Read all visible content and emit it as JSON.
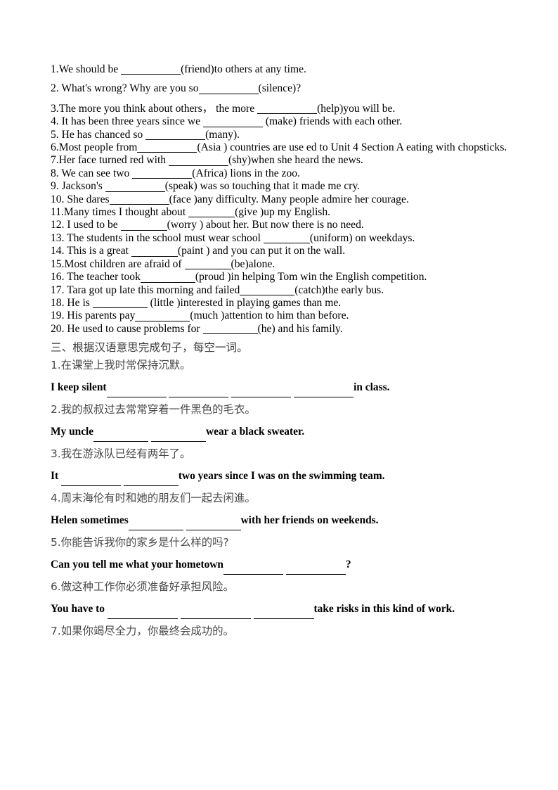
{
  "document": {
    "type": "english-grammar-worksheet",
    "page_background": "#ffffff",
    "text_color": "#000000"
  },
  "part_two": {
    "items": [
      {
        "number": "1.",
        "before": "We should be ",
        "blank_width": 85,
        "after": "(friend)to others at any time."
      },
      {
        "number": "2. ",
        "before": "What's wrong? Why are you so",
        "blank_width": 85,
        "after": "(silence)?"
      },
      {
        "number": "3.",
        "before": "The more you think about others，   the more ",
        "blank_width": 85,
        "after": "(help)you will be."
      },
      {
        "number": "4. ",
        "before": "It has been three years since we ",
        "blank_width": 85,
        "after": " (make) friends with each other."
      },
      {
        "number": "5. ",
        "before": "He has chanced so ",
        "blank_width": 85,
        "after": "(many)."
      },
      {
        "number": "6.",
        "before": "Most people from",
        "blank_width": 85,
        "after": "(Asia ) countries are use ed to Unit 4 Section A eating with chopsticks."
      },
      {
        "number": "7.",
        "before": "Her face turned red with ",
        "blank_width": 85,
        "after": "(shy)when she heard the news."
      },
      {
        "number": "8. ",
        "before": "We can see two ",
        "blank_width": 85,
        "after": "(Africa) lions in the zoo."
      },
      {
        "number": "9. ",
        "before": "Jackson's ",
        "blank_width": 85,
        "after": "(speak) was so touching that it made me cry."
      },
      {
        "number": "10. ",
        "before": "She dares",
        "blank_width": 85,
        "after": "(face )any difficulty. Many people admire her courage."
      },
      {
        "number": "11.",
        "before": "Many times I thought about ",
        "blank_width": 66,
        "after": "(give )up my English."
      },
      {
        "number": "12. ",
        "before": "I used to be ",
        "blank_width": 66,
        "after": "(worry ) about her. But now there is no need."
      },
      {
        "number": "13. ",
        "before": "The students in the school must wear school ",
        "blank_width": 66,
        "after": "(uniform) on weekdays."
      },
      {
        "number": "14. ",
        "before": "This is a great ",
        "blank_width": 66,
        "after": "(paint ) and you can put it on the wall."
      },
      {
        "number": "15.",
        "before": "Most children are afraid of ",
        "blank_width": 66,
        "after": "(be)alone."
      },
      {
        "number": "16. ",
        "before": "The teacher took",
        "blank_width": 78,
        "after": "(proud )in helping Tom win the English competition."
      },
      {
        "number": "17. ",
        "before": "Tara got up late this morning and failed",
        "blank_width": 78,
        "after": "(catch)the early bus."
      },
      {
        "number": "18. ",
        "before": "He is ",
        "blank_width": 78,
        "after": " (little )interested in playing games than me."
      },
      {
        "number": "19. ",
        "before": "His parents pay",
        "blank_width": 78,
        "after": "(much )attention to him than before."
      },
      {
        "number": "20. ",
        "before": "He used to cause problems for ",
        "blank_width": 78,
        "after": "(he) and his family."
      }
    ]
  },
  "part_three": {
    "heading": "三、根据汉语意思完成句子，每空一词。",
    "items": [
      {
        "number": "1.",
        "chinese": "在课堂上我时常保持沉默。",
        "en_before": "I keep silent",
        "blanks": [
          85,
          85,
          85,
          85
        ],
        "en_after": "in class.",
        "indent": false
      },
      {
        "number": "2.",
        "chinese": "我的叔叔过去常常穿着一件黑色的毛衣。",
        "en_before": " My uncle",
        "blanks": [
          78,
          78
        ],
        "en_after": "wear a black sweater.",
        "indent": false
      },
      {
        "number": "3.",
        "chinese": "我在游泳队已经有两年了。",
        "en_before": "It ",
        "blanks": [
          85,
          78
        ],
        "en_after": "two years since I was on the swimming team.",
        "indent": false
      },
      {
        "number": "4.",
        "chinese": "周末海伦有时和她的朋友们一起去闲進。",
        "en_before": " Helen sometimes",
        "blanks": [
          78,
          78
        ],
        "en_after": "with her friends on weekends.",
        "indent": false
      },
      {
        "number": "5.",
        "chinese": "你能告诉我你的家乡是什么样的吗?",
        "en_before": " Can you tell me what your hometown",
        "blanks": [
          85,
          85
        ],
        "en_after": "?",
        "indent": false
      },
      {
        "number": "6.",
        "chinese": "做这种工作你必须准备好承担风险。",
        "en_before": "You have to ",
        "blanks": [
          100,
          100,
          86
        ],
        "en_after": "take risks in this kind of work.",
        "indent": false
      },
      {
        "number": "7.",
        "chinese": "如果你竭尽全力，你最终会成功的。",
        "en_before": "",
        "blanks": [],
        "en_after": "",
        "indent": false
      }
    ]
  }
}
